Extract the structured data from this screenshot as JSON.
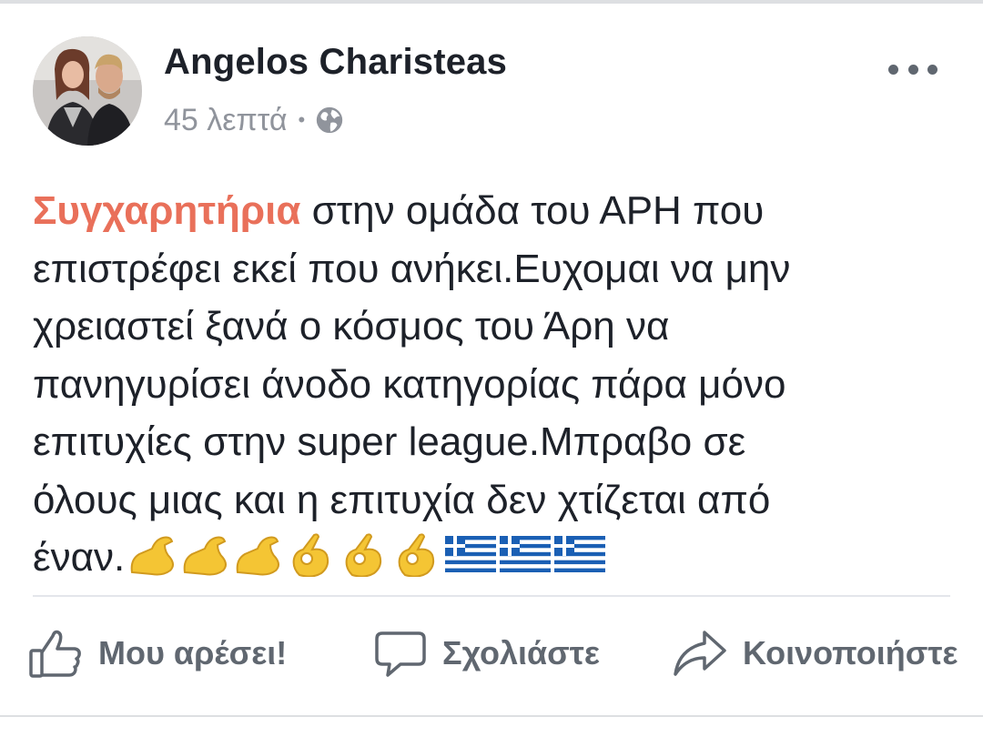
{
  "post": {
    "author": "Angelos Charisteas",
    "time": "45 λεπτά",
    "privacy_icon": "globe-icon",
    "more_icon": "more-dots-icon",
    "highlight": "Συγχαρητήρια",
    "lines": [
      " στην ομάδα του ΑΡΗ που",
      "επιστρέφει εκεί που ανήκει.Ευχομαι να μην",
      "χρειαστεί ξανά ο κόσμος του Άρη να",
      "πανηγυρίσει άνοδο κατηγορίας  πάρα μόνο",
      "επιτυχίες στην super league.Μπραβο σε",
      "όλους μιας και η επιτυχία δεν χτίζεται από",
      "έναν."
    ],
    "emojis": [
      "flexed-biceps",
      "flexed-biceps",
      "flexed-biceps",
      "ok-hand",
      "ok-hand",
      "ok-hand",
      "greece-flag",
      "greece-flag",
      "greece-flag"
    ]
  },
  "actions": {
    "like": "Μου αρέσει!",
    "comment": "Σχολιάστε",
    "share": "Κοινοποιήστε"
  },
  "colors": {
    "highlight": "#e9705a",
    "text": "#1d2129",
    "meta": "#90949c",
    "action": "#606770",
    "flag_blue": "#1a5fb4"
  }
}
